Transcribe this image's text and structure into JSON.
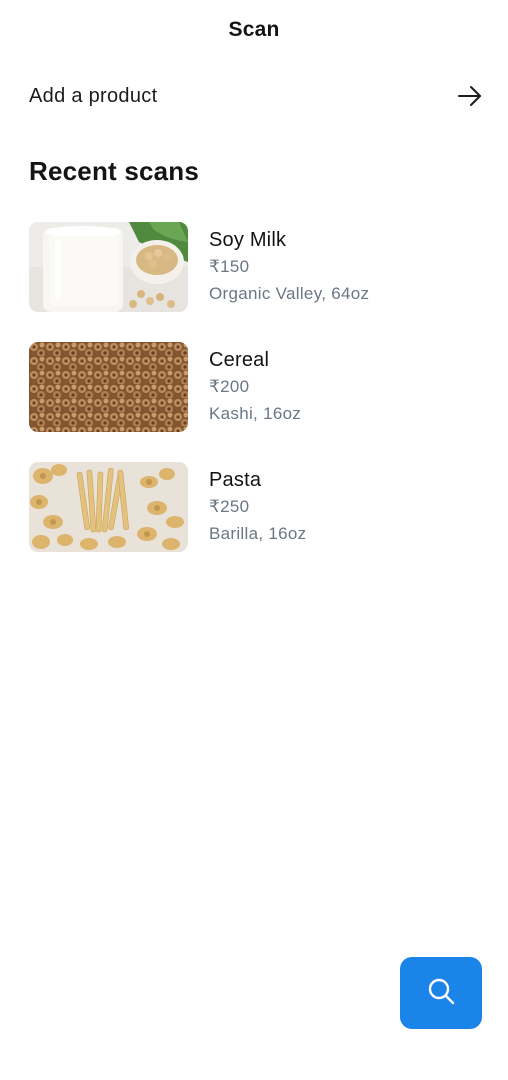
{
  "header": {
    "title": "Scan"
  },
  "add_product": {
    "label": "Add a product",
    "icon": "arrow-right-icon"
  },
  "recent": {
    "title": "Recent scans",
    "items": [
      {
        "name": "Soy Milk",
        "price": "₹150",
        "meta": "Organic Valley, 64oz",
        "image": "soy-milk-photo"
      },
      {
        "name": "Cereal",
        "price": "₹200",
        "meta": "Kashi, 16oz",
        "image": "cereal-photo"
      },
      {
        "name": "Pasta",
        "price": "₹250",
        "meta": "Barilla, 16oz",
        "image": "pasta-photo"
      }
    ]
  },
  "fab": {
    "icon": "search-icon"
  },
  "colors": {
    "accent": "#1a84e8",
    "text_primary": "#141414",
    "text_secondary": "#6b7785"
  }
}
